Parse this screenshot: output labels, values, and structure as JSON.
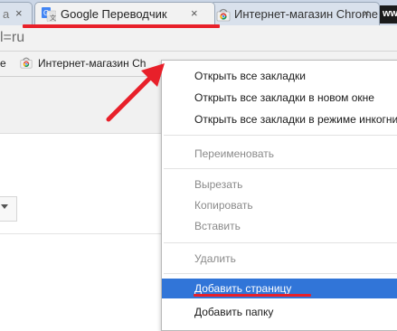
{
  "tabs": [
    {
      "label": "а",
      "partially_visible": true
    },
    {
      "label": "Google Переводчик",
      "active": true,
      "icon": "google-translate-icon"
    },
    {
      "label": "Интернет-магазин Chrome",
      "icon": "chrome-web-store-icon"
    }
  ],
  "tab_close_glyph": "×",
  "new_tab_fragment": "www",
  "address_bar": {
    "visible_text": "l=ru"
  },
  "bookmarks_bar": {
    "left_fragment": "e",
    "store_label": "Интернет-магазин Ch"
  },
  "context_menu": {
    "items": [
      {
        "label": "Открыть все закладки",
        "enabled": true
      },
      {
        "label": "Открыть все закладки в новом окне",
        "enabled": true
      },
      {
        "label": "Открыть все закладки в режиме инкогнито",
        "enabled": true
      },
      {
        "label": "Переименовать",
        "enabled": false
      },
      {
        "label": "Вырезать",
        "enabled": false
      },
      {
        "label": "Копировать",
        "enabled": false
      },
      {
        "label": "Вставить",
        "enabled": false
      },
      {
        "label": "Удалить",
        "enabled": false
      },
      {
        "label": "Добавить страницу",
        "enabled": true,
        "highlighted": true
      },
      {
        "label": "Добавить папку",
        "enabled": true
      }
    ]
  },
  "colors": {
    "highlight": "#3175d8",
    "annotation": "#e8202a",
    "tabstrip": "#cbd6e6"
  }
}
